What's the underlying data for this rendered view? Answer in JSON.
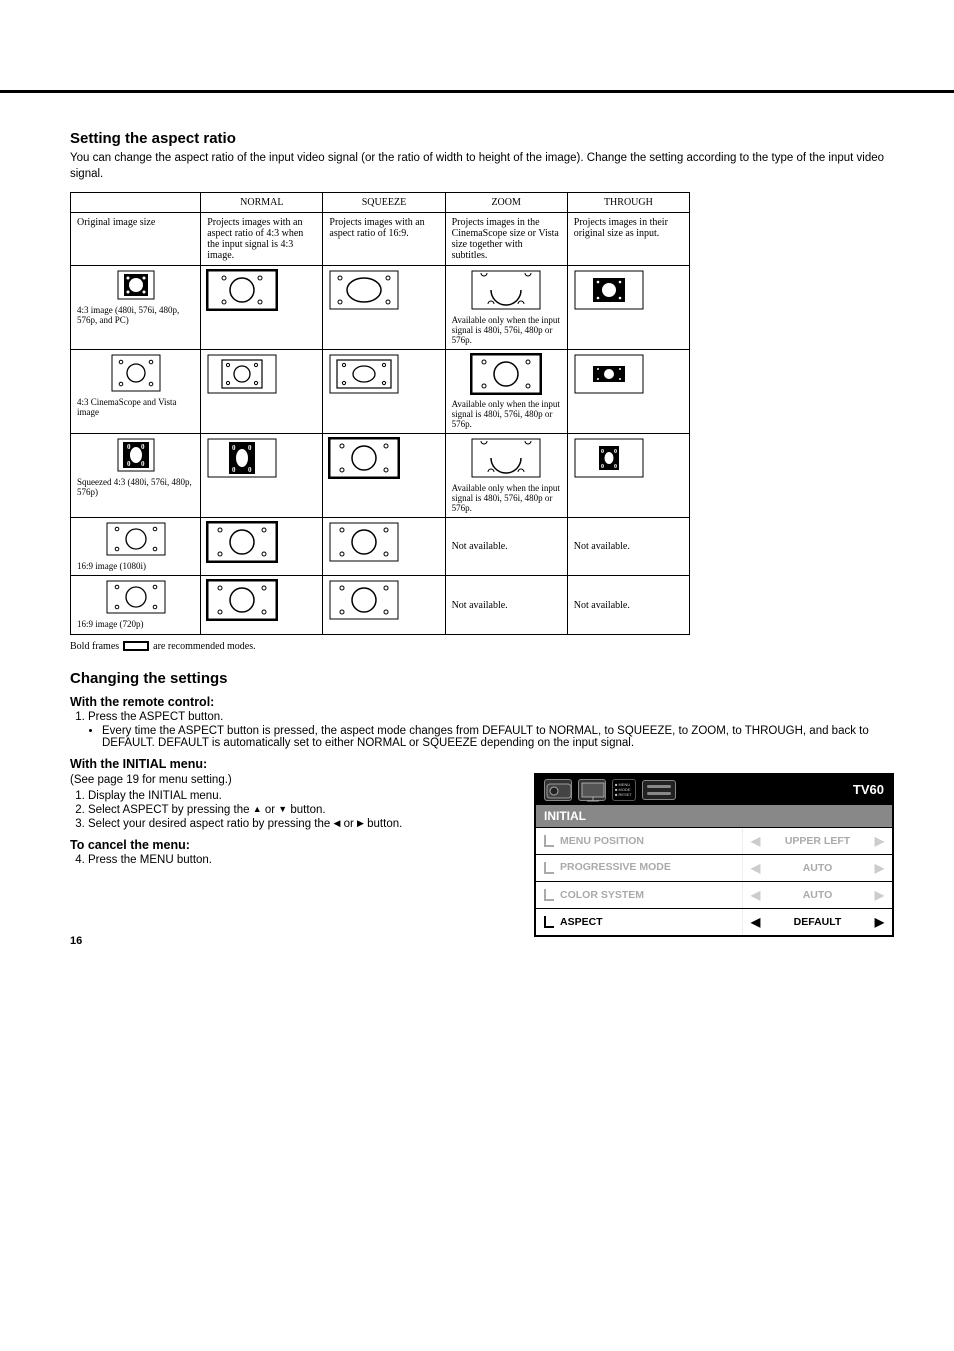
{
  "headings": {
    "h1": "Setting the aspect ratio",
    "intro": "You can change the aspect ratio of the input video signal (or the ratio of width to height of the image). Change the setting according to the type of the input video signal.",
    "h2": "Changing the settings",
    "remote_head": "With the remote control:",
    "initial_head": "With the INITIAL menu:",
    "cancel_head": "To cancel the menu:"
  },
  "table": {
    "cols": [
      "NORMAL",
      "SQUEEZE",
      "ZOOM",
      "THROUGH"
    ],
    "row0_label": "Original image size",
    "row0": [
      "Projects images with an aspect ratio of 4:3 when the input signal is 4:3 image.",
      "Projects images with an aspect ratio of 16:9.",
      "Projects images in the CinemaScope size or Vista size together with subtitles.",
      "Projects images in their original size as input."
    ],
    "row_labels": [
      "4:3 image (480i, 576i, 480p, 576p, and PC)",
      "4:3 CinemaScope and Vista image",
      "Squeezed 4:3 (480i, 576i, 480p, 576p)",
      "16:9 image (1080i)",
      "16:9 image (720p)"
    ],
    "avail_note": "Available only when the input signal is 480i, 576i, 480p or 576p.",
    "not_avail": "Not available.",
    "legend_pre": "Bold frames",
    "legend_post": "are recommended modes."
  },
  "remote_steps": {
    "s1": "Press the ASPECT button.",
    "bullet": "Every time the ASPECT button is pressed, the aspect mode changes from DEFAULT to NORMAL, to SQUEEZE, to ZOOM, to THROUGH, and back to DEFAULT. DEFAULT is automatically set to either NORMAL or SQUEEZE depending on the input signal."
  },
  "initial_steps": {
    "see": "(See page 19 for menu setting.)",
    "s1": "Display the INITIAL menu.",
    "s2_pre": "Select ASPECT by pressing the ",
    "s2_mid": " or ",
    "s2_post": " button.",
    "s3_pre": "Select your desired aspect ratio by pressing the ",
    "s3_mid": " or ",
    "s3_post": " button.",
    "s4": "Press the MENU button."
  },
  "menu": {
    "title_right": "TV60",
    "icon_txt": "MENU\nMODE\nRESET",
    "section": "INITIAL",
    "rows": [
      {
        "label": "MENU POSITION",
        "value": "UPPER LEFT",
        "dim": true
      },
      {
        "label": "PROGRESSIVE MODE",
        "value": "AUTO",
        "dim": true,
        "twoLine": true
      },
      {
        "label": "COLOR SYSTEM",
        "value": "AUTO",
        "dim": true
      },
      {
        "label": "ASPECT",
        "value": "DEFAULT",
        "dim": false
      }
    ]
  },
  "page_number": "16"
}
